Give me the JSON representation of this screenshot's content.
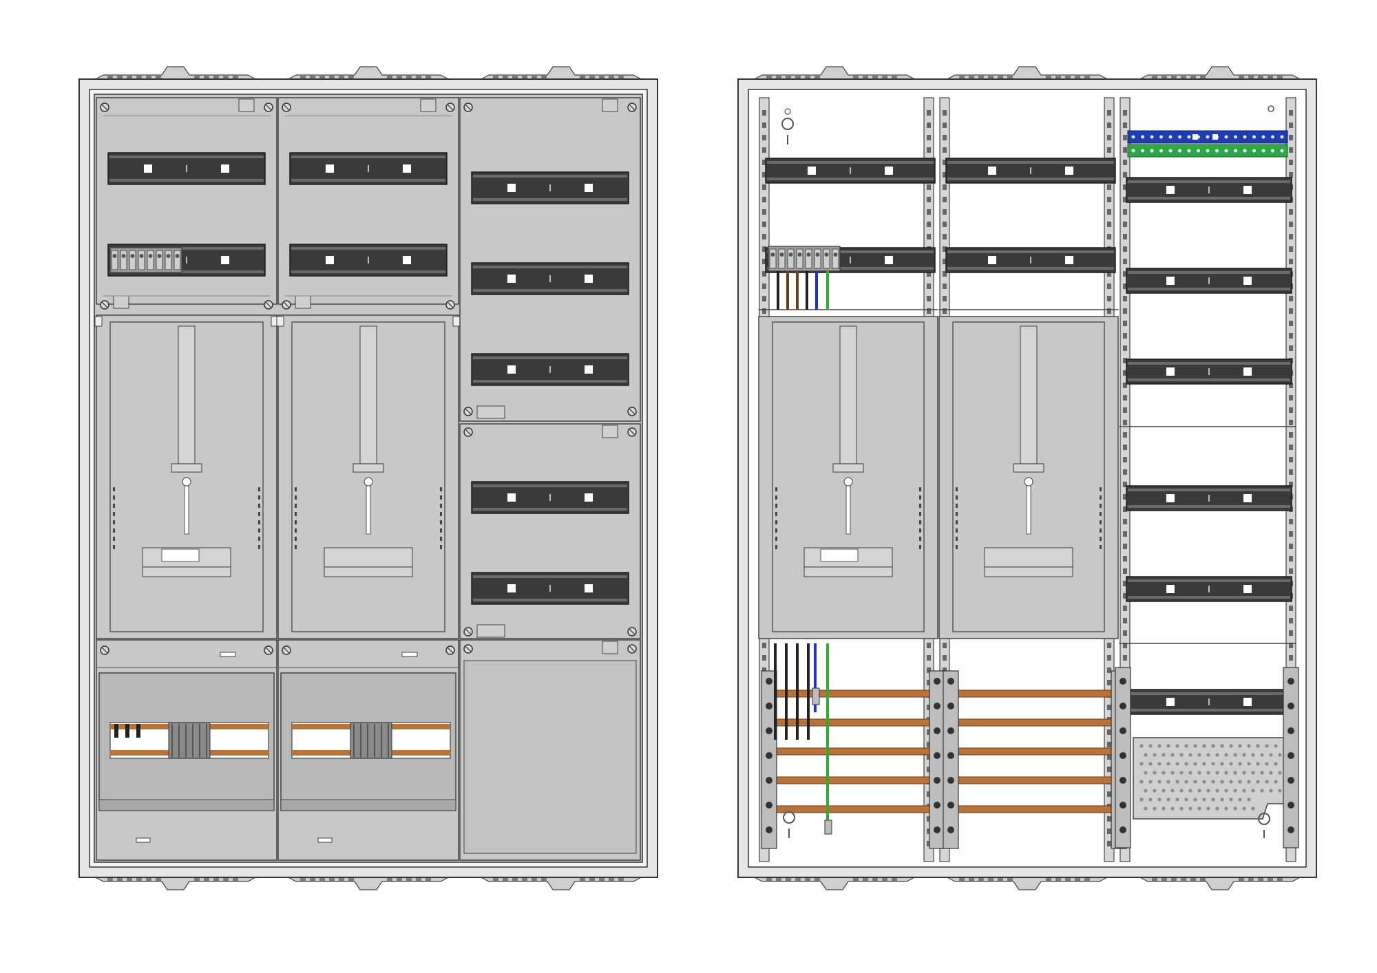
{
  "colors": {
    "background": "#ffffff",
    "housing": "#e6e6e6",
    "panel": "#c8c8c8",
    "panel_dark": "#b9b9b9",
    "rail": "#3a3a3a",
    "rail_slot": "#ffffff",
    "frame_line": "#555555",
    "busbar": "#b8733a",
    "wire_black": "#222222",
    "wire_brown": "#6b3e1c",
    "wire_blue": "#2233cc",
    "wire_green": "#33aa33",
    "terminal_blue": "#1f3db3",
    "terminal_green": "#2fa64a",
    "cutout": "#ffffff"
  },
  "views": [
    {
      "id": "left-cabinet",
      "icon": "closed-cabinet-icon",
      "style": "covered"
    },
    {
      "id": "right-cabinet",
      "icon": "open-cabinet-icon",
      "style": "open"
    }
  ]
}
